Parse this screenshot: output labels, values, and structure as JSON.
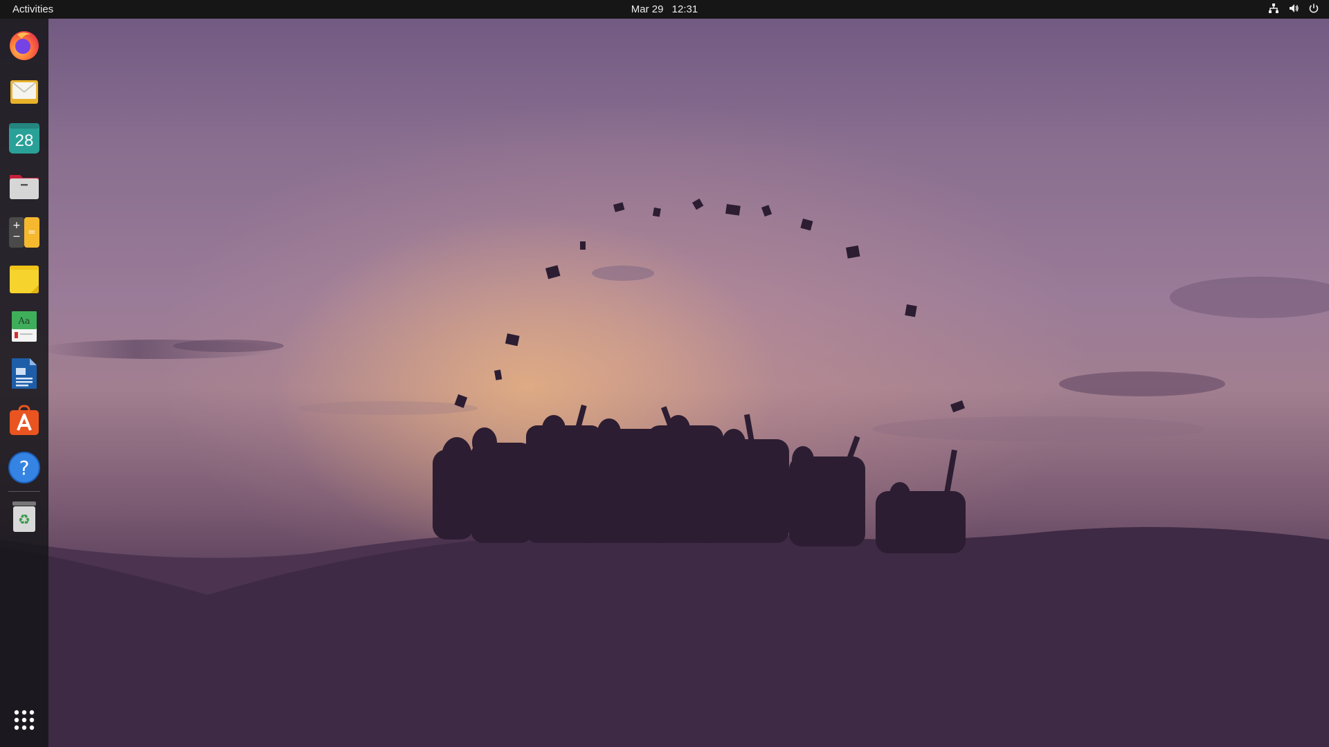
{
  "topbar": {
    "activities_label": "Activities",
    "date": "Mar 29",
    "time": "12:31",
    "tray_icons": [
      "network-icon",
      "volume-icon",
      "power-icon"
    ]
  },
  "dock": {
    "apps": [
      {
        "name": "firefox",
        "icon": "firefox-icon"
      },
      {
        "name": "thunderbird",
        "icon": "mail-icon"
      },
      {
        "name": "calendar",
        "icon": "calendar-icon",
        "label": "28"
      },
      {
        "name": "files",
        "icon": "files-icon"
      },
      {
        "name": "calculator",
        "icon": "calculator-icon",
        "label_plus": "+",
        "label_minus": "−",
        "label_equals": "="
      },
      {
        "name": "notes",
        "icon": "sticky-notes-icon"
      },
      {
        "name": "dictionary",
        "icon": "dictionary-icon",
        "label": "Aa"
      },
      {
        "name": "writer",
        "icon": "libreoffice-writer-icon"
      },
      {
        "name": "software",
        "icon": "app-store-icon"
      },
      {
        "name": "help",
        "icon": "help-icon",
        "label": "?"
      },
      {
        "name": "trash",
        "icon": "trash-icon",
        "label": "♻"
      },
      {
        "name": "show-apps",
        "icon": "app-grid-icon"
      }
    ]
  },
  "wallpaper": {
    "subject": "graduates-silhouette-sunset",
    "colors": {
      "sky_top": "#6e5780",
      "glow": "#ffc478",
      "ground": "#3f2c46"
    }
  }
}
